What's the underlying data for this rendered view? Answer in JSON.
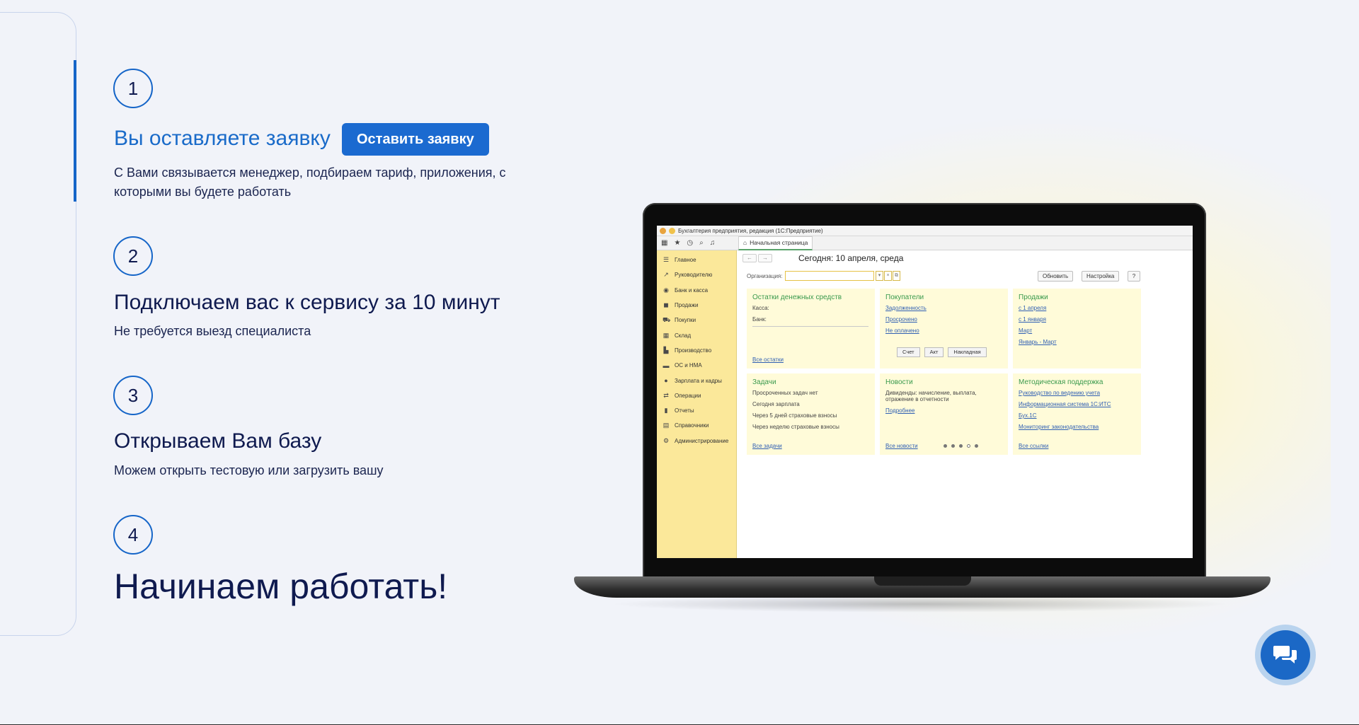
{
  "steps": [
    {
      "number": "1",
      "title": "Вы оставляете заявку",
      "description": "С Вами связывается менеджер, подбираем тариф, приложения, с которыми вы будете работать"
    },
    {
      "number": "2",
      "title": "Подключаем вас к сервису за 10 минут",
      "description": "Не требуется выезд специалиста"
    },
    {
      "number": "3",
      "title": "Открываем Вам базу",
      "description": "Можем открыть тестовую или загрузить вашу"
    },
    {
      "number": "4",
      "title": "Начинаем работать!"
    }
  ],
  "cta_label": "Оставить заявку",
  "colors": {
    "accent": "#1b6ad0",
    "title_blue": "#1a6bc9",
    "text_dark": "#0f1a4f",
    "app_sidebar": "#fbe89a",
    "app_panel": "#fffbd9"
  },
  "app": {
    "window_title": "Бухгалтерия предприятия, редакция  (1С:Предприятие)",
    "tab_label": "Начальная страница",
    "date": "Сегодня: 10 апреля, среда",
    "org_label": "Организация:",
    "buttons": {
      "refresh": "Обновить",
      "settings": "Настройка",
      "help": "?"
    },
    "sidebar": [
      {
        "icon": "list-icon",
        "label": "Главное"
      },
      {
        "icon": "chart-icon",
        "label": "Руководителю"
      },
      {
        "icon": "bank-icon",
        "label": "Банк и касса"
      },
      {
        "icon": "bag-icon",
        "label": "Продажи"
      },
      {
        "icon": "cart-icon",
        "label": "Покупки"
      },
      {
        "icon": "warehouse-icon",
        "label": "Склад"
      },
      {
        "icon": "factory-icon",
        "label": "Производство"
      },
      {
        "icon": "truck-icon",
        "label": "ОС и НМА"
      },
      {
        "icon": "person-icon",
        "label": "Зарплата и кадры"
      },
      {
        "icon": "operations-icon",
        "label": "Операции"
      },
      {
        "icon": "reports-icon",
        "label": "Отчеты"
      },
      {
        "icon": "book-icon",
        "label": "Справочники"
      },
      {
        "icon": "gear-icon",
        "label": "Администрирование"
      }
    ],
    "panels": {
      "cash": {
        "title": "Остатки денежных средств",
        "lines": [
          "Касса:",
          "Банк:"
        ],
        "footer": "Все остатки"
      },
      "buyers": {
        "title": "Покупатели",
        "links": [
          "Задолженность",
          "Просрочено",
          "Не оплачено"
        ],
        "actions": [
          "Счет",
          "Акт",
          "Накладная"
        ]
      },
      "sales": {
        "title": "Продажи",
        "links": [
          "с 1 апреля",
          "с 1 января",
          "Март",
          "Январь - Март"
        ]
      },
      "tasks": {
        "title": "Задачи",
        "lines": [
          "Просроченных задач нет",
          "Сегодня зарплата",
          "Через 5 дней страховые взносы",
          "Через неделю страховые взносы"
        ],
        "footer": "Все задачи"
      },
      "news": {
        "title": "Новости",
        "text": "Дивиденды: начисление, выплата, отражение в отчетности",
        "more": "Подробнее",
        "footer": "Все новости"
      },
      "support": {
        "title": "Методическая поддержка",
        "links": [
          "Руководство по ведению учета",
          "Информационная система 1С:ИТС",
          "Бух.1С",
          "Мониторинг законодательства"
        ],
        "footer": "Все ссылки"
      }
    }
  }
}
